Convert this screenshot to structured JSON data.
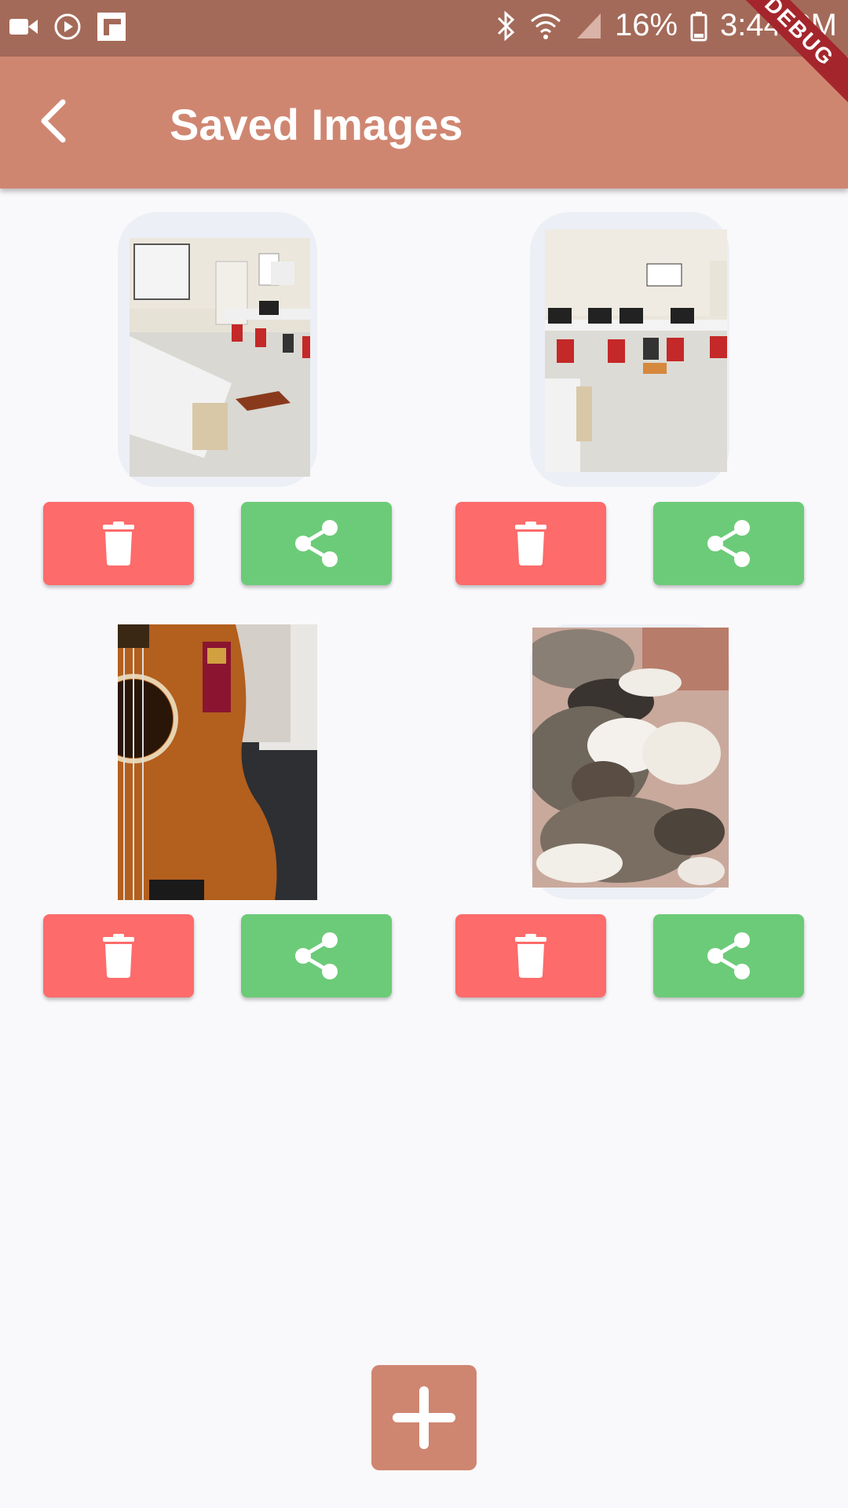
{
  "status_bar": {
    "battery": "16%",
    "time": "3:44 PM",
    "icons": [
      "video-icon",
      "play-circle-icon",
      "flipboard-icon",
      "bluetooth-icon",
      "wifi-icon",
      "signal-icon",
      "battery-icon"
    ]
  },
  "app_bar": {
    "title": "Saved Images",
    "back_icon": "chevron-left-icon"
  },
  "debug_banner": "DEBUG",
  "colors": {
    "status": "#a46a59",
    "appbar": "#cf8671",
    "delete": "#fd6b6b",
    "share": "#6ccb78",
    "card": "#eceff5"
  },
  "images": [
    {
      "subject": "classroom-tables-chairs",
      "delete_icon": "trash-icon",
      "share_icon": "share-icon"
    },
    {
      "subject": "computer-lab-desks",
      "delete_icon": "trash-icon",
      "share_icon": "share-icon"
    },
    {
      "subject": "acoustic-guitar",
      "delete_icon": "trash-icon",
      "share_icon": "share-icon"
    },
    {
      "subject": "sleeping-kittens",
      "delete_icon": "trash-icon",
      "share_icon": "share-icon"
    }
  ],
  "fab": {
    "icon": "plus-icon"
  }
}
